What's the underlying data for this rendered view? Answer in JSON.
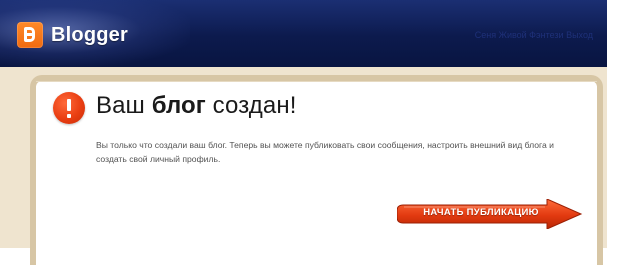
{
  "header": {
    "brand": "Blogger",
    "links": "Сеня Живой Фэнтези Выход",
    "logo_icon": "blogger-logo-icon"
  },
  "main": {
    "alert_icon": "exclamation-icon",
    "title_part1": "Ваш ",
    "title_bold": "блог",
    "title_part2": " создан!",
    "message": "Вы только что создали ваш блог. Теперь вы можете публиковать свои сообщения, настроить внешний вид блога и создать свой личный профиль.",
    "cta_label": "НАЧАТЬ ПУБЛИКАЦИЮ"
  },
  "colors": {
    "header_bg": "#0c1a4d",
    "logo_orange": "#f06a10",
    "panel_border": "#d7c6a5",
    "alert_red": "#e93e12",
    "cta_red": "#dd3a12"
  }
}
